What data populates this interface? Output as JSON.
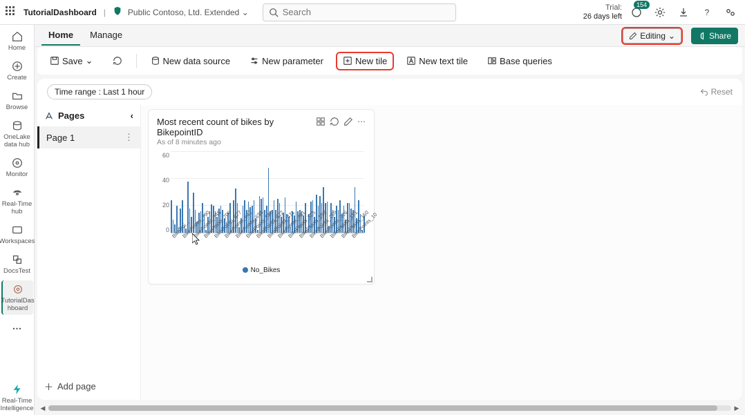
{
  "topbar": {
    "title": "TutorialDashboard",
    "workspace": "Public Contoso, Ltd. Extended",
    "search_placeholder": "Search",
    "trial_line1": "Trial:",
    "trial_line2": "26 days left",
    "badge_count": "154"
  },
  "leftrail": {
    "items": [
      {
        "key": "home",
        "label": "Home"
      },
      {
        "key": "create",
        "label": "Create"
      },
      {
        "key": "browse",
        "label": "Browse"
      },
      {
        "key": "onelake",
        "label": "OneLake\ndata hub"
      },
      {
        "key": "monitor",
        "label": "Monitor"
      },
      {
        "key": "realtimehub",
        "label": "Real-Time\nhub"
      },
      {
        "key": "workspaces",
        "label": "Workspaces"
      },
      {
        "key": "docstest",
        "label": "DocsTest"
      },
      {
        "key": "tutorial",
        "label": "TutorialDas\nhboard"
      }
    ],
    "more_label": "…",
    "footer_label": "Real-Time\nIntelligence"
  },
  "tabs": {
    "home": "Home",
    "manage": "Manage",
    "editing": "Editing",
    "share": "Share"
  },
  "toolbar": {
    "save": "Save",
    "new_data_source": "New data source",
    "new_parameter": "New parameter",
    "new_tile": "New tile",
    "new_text_tile": "New text tile",
    "base_queries": "Base queries"
  },
  "timebar": {
    "time_chip": "Time range : Last 1 hour",
    "reset": "Reset"
  },
  "pagespanel": {
    "header": "Pages",
    "page1": "Page 1",
    "add_page": "Add page"
  },
  "tile": {
    "title": "Most recent count of bikes by BikepointID",
    "subtitle": "As of 8 minutes ago",
    "legend": "No_Bikes"
  },
  "chart_data": {
    "type": "bar",
    "title": "Most recent count of bikes by BikepointID",
    "xlabel": "",
    "ylabel": "",
    "ylim": [
      0,
      60
    ],
    "yticks": [
      0,
      20,
      40,
      60
    ],
    "xtick_labels": [
      "BikePoi...",
      "BikePoints_790",
      "BikePoints_745",
      "BikePoints_706",
      "BikePoints_677",
      "BikePoints_642",
      "BikePoints_634",
      "BikePoints_589",
      "BikePoints_522",
      "BikePoints_471",
      "BikePoints_381",
      "BikePoints_325",
      "BikePoints_292",
      "BikePoints_259",
      "BikePoints_226",
      "BikePoints_181",
      "BikePoints_150",
      "BikePoints_10"
    ],
    "series": [
      {
        "name": "No_Bikes",
        "values": [
          24,
          10,
          6,
          20,
          4,
          18,
          24,
          5,
          3,
          38,
          18,
          12,
          30,
          17,
          8,
          15,
          16,
          22,
          14,
          2,
          12,
          16,
          21,
          20,
          16,
          12,
          18,
          20,
          17,
          11,
          8,
          15,
          22,
          8,
          24,
          33,
          22,
          4,
          11,
          20,
          24,
          17,
          23,
          19,
          20,
          24,
          11,
          2,
          27,
          25,
          26,
          17,
          20,
          48,
          16,
          17,
          24,
          17,
          25,
          22,
          12,
          15,
          26,
          14,
          12,
          4,
          16,
          13,
          23,
          16,
          17,
          16,
          13,
          22,
          2,
          14,
          23,
          24,
          12,
          28,
          20,
          27,
          22,
          34,
          22,
          23,
          5,
          22,
          17,
          12,
          20,
          17,
          24,
          14,
          20,
          10,
          22,
          22,
          18,
          17,
          34,
          11,
          24,
          14,
          2,
          13
        ]
      }
    ]
  }
}
